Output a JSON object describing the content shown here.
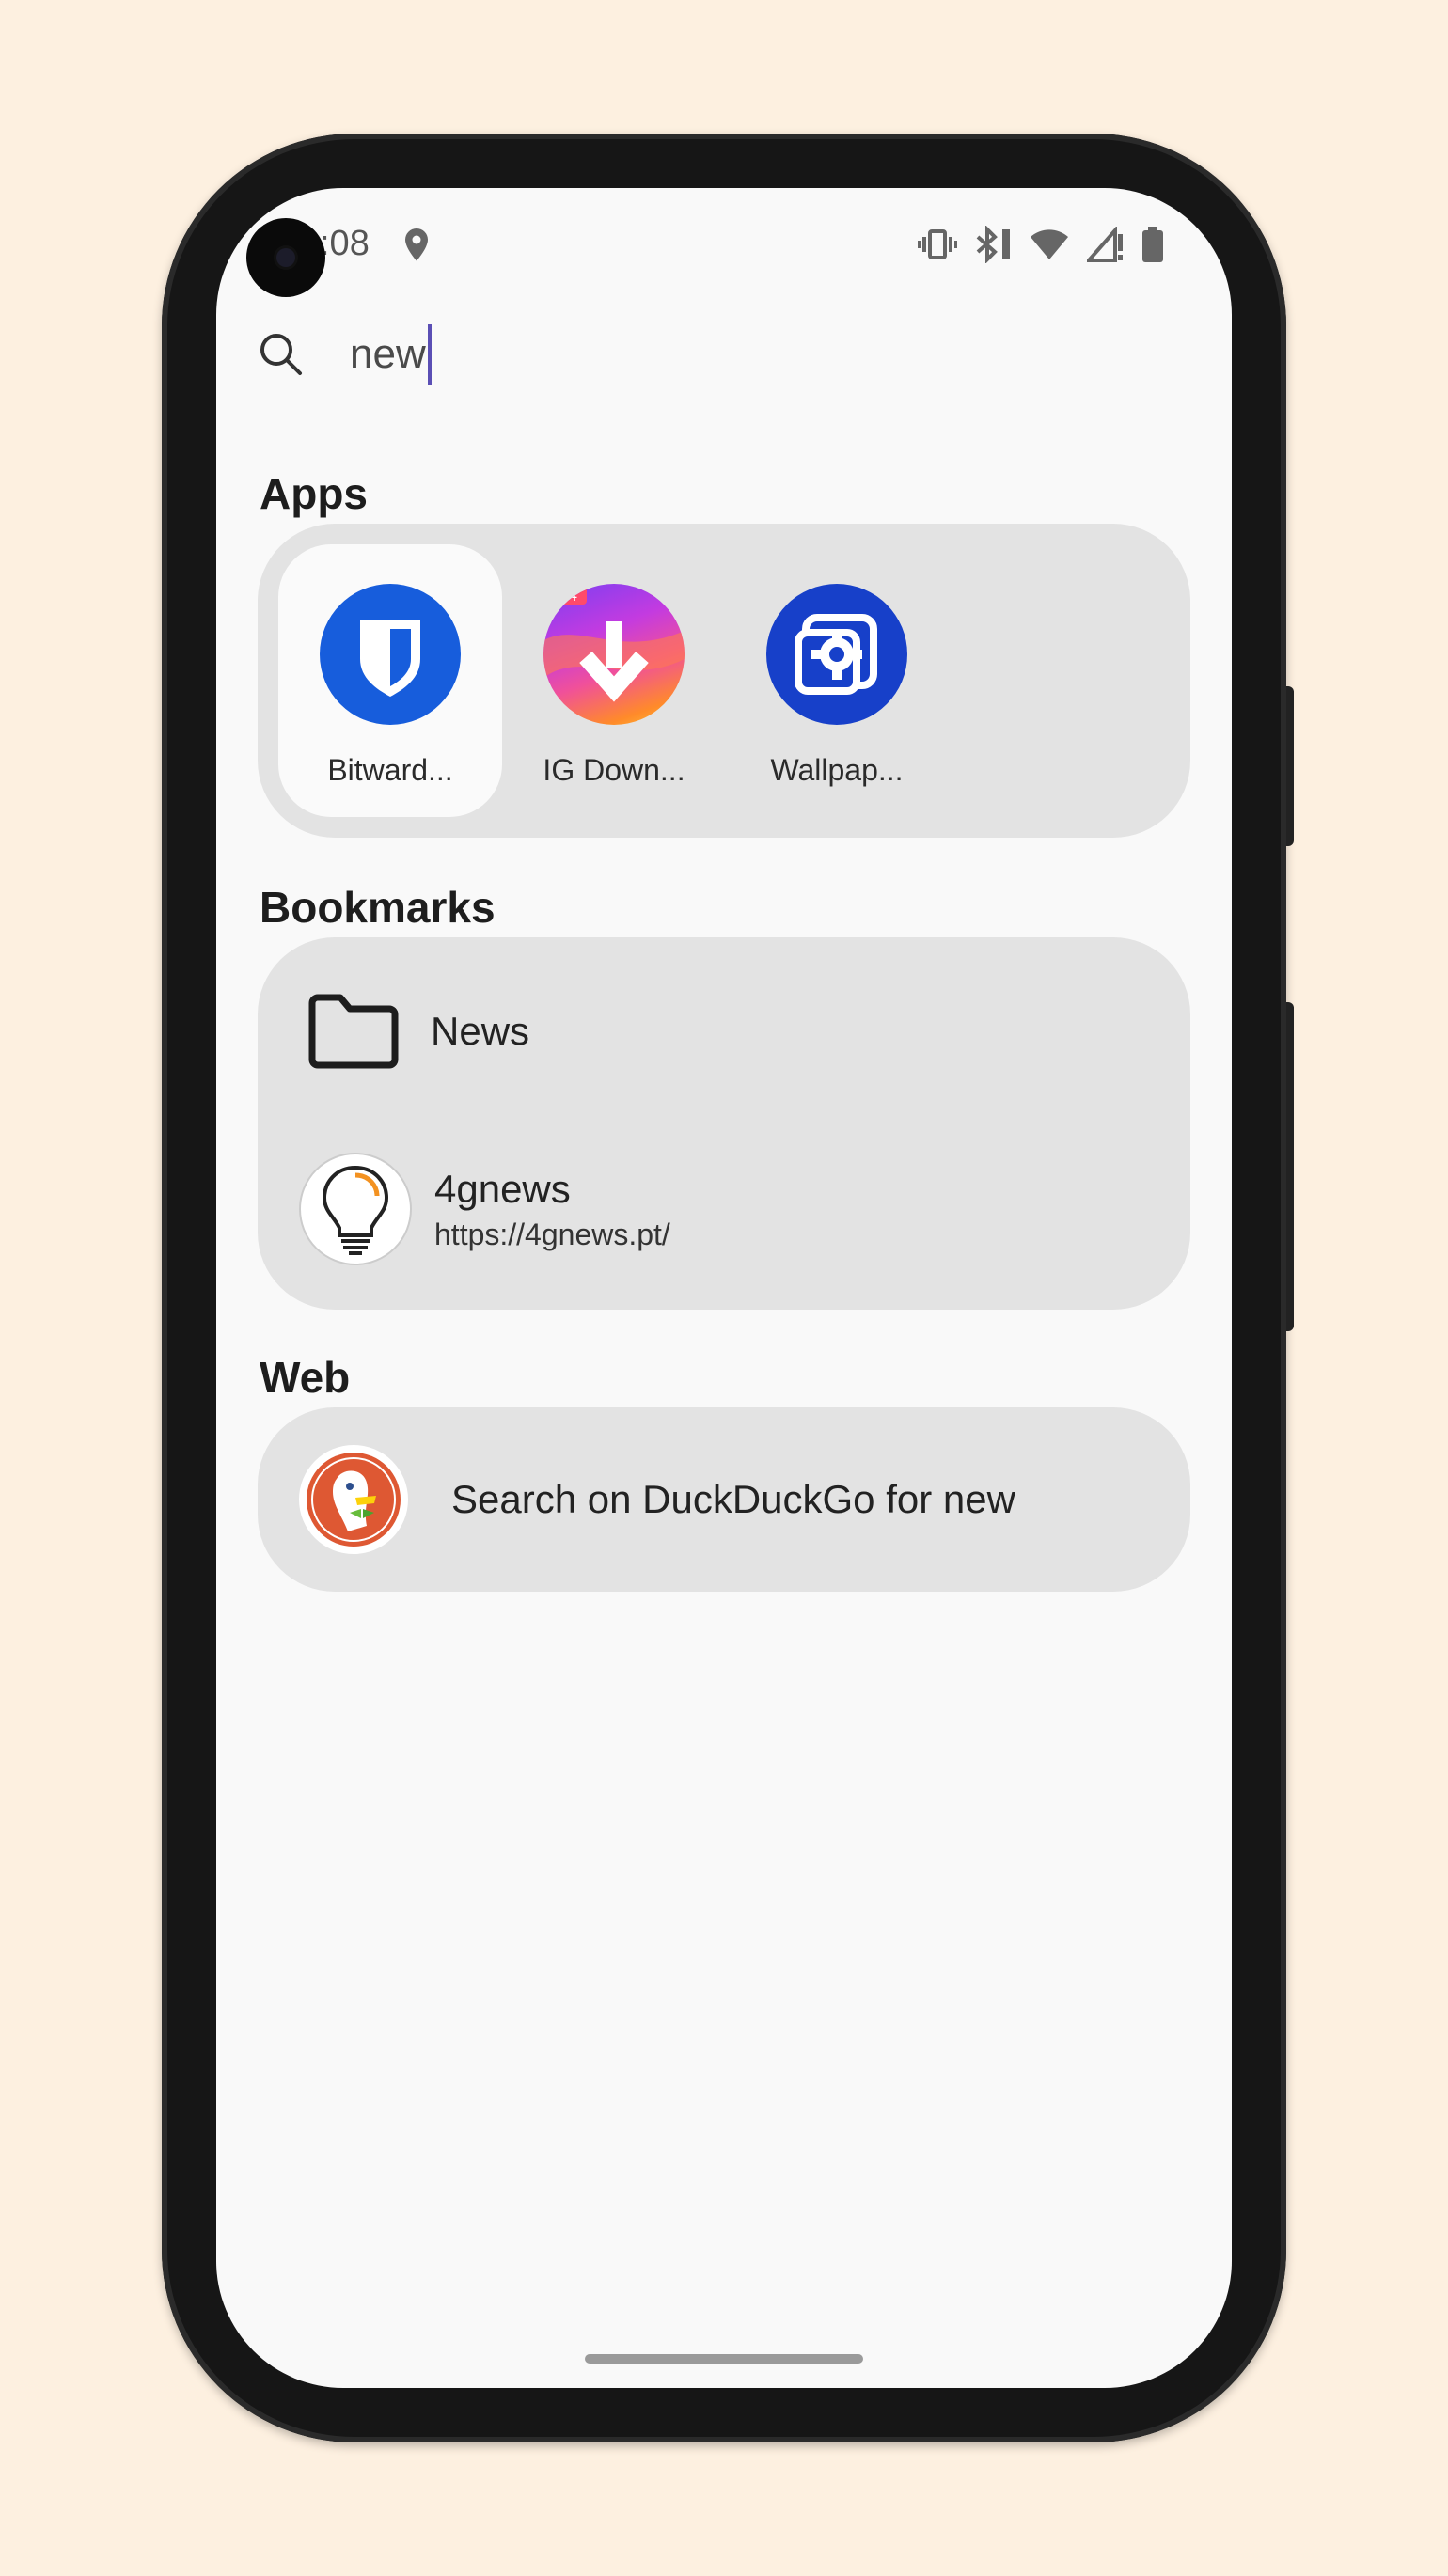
{
  "status_bar": {
    "time": ":08"
  },
  "search": {
    "query": "new"
  },
  "sections": {
    "apps_title": "Apps",
    "bookmarks_title": "Bookmarks",
    "web_title": "Web"
  },
  "apps": [
    {
      "label": "Bitward...",
      "icon": "bitwarden-icon"
    },
    {
      "label": "IG Down...",
      "icon": "ig-downloader-icon"
    },
    {
      "label": "Wallpap...",
      "icon": "wallpaper-settings-icon"
    }
  ],
  "bookmarks": {
    "folder": {
      "label": "News",
      "icon": "folder-icon"
    },
    "site": {
      "title": "4gnews",
      "url": "https://4gnews.pt/",
      "icon": "lightbulb-icon"
    }
  },
  "web": {
    "label": "Search on DuckDuckGo for new",
    "icon": "duckduckgo-icon"
  },
  "colors": {
    "background": "#fdf0e0",
    "screen": "#f9f9f9",
    "card": "#e3e3e3",
    "accent": "#5b4fb5"
  }
}
